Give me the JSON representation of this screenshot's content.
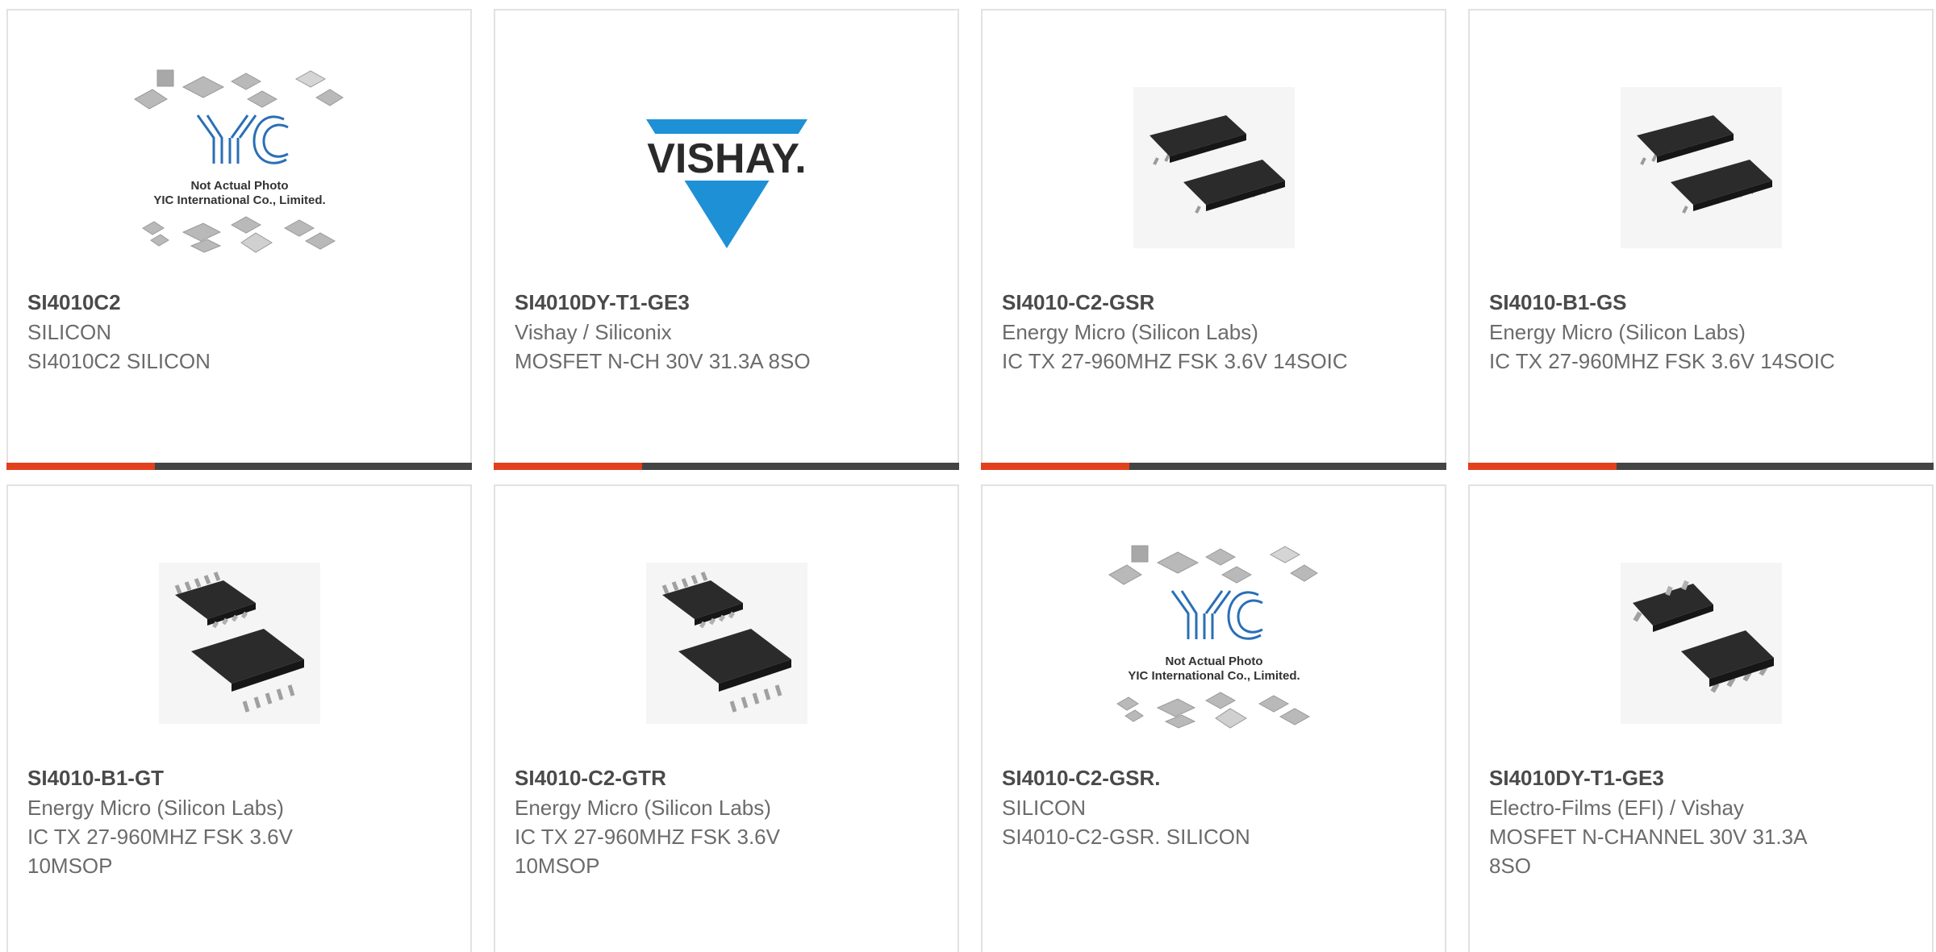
{
  "colors": {
    "accent": "#e2401c",
    "bar": "#444444",
    "vishay_blue": "#1e90d6",
    "chip": "#2b2b2b",
    "yic_blue": "#2a6fb5"
  },
  "placeholder": {
    "line1": "Not Actual Photo",
    "line2": "YIC International Co., Limited."
  },
  "products": [
    {
      "part_number": "SI4010C2",
      "manufacturer": "SILICON",
      "description": "SI4010C2 SILICON",
      "image": "yic-placeholder"
    },
    {
      "part_number": "SI4010DY-T1-GE3",
      "manufacturer": "Vishay / Siliconix",
      "description": "MOSFET N-CH 30V 31.3A 8SO",
      "image": "vishay-logo",
      "logo_text": "VISHAY."
    },
    {
      "part_number": "SI4010-C2-GSR",
      "manufacturer": "Energy Micro (Silicon Labs)",
      "description": "IC TX 27-960MHZ FSK 3.6V 14SOIC",
      "image": "soic14-chip"
    },
    {
      "part_number": "SI4010-B1-GS",
      "manufacturer": "Energy Micro (Silicon Labs)",
      "description": "IC TX 27-960MHZ FSK 3.6V 14SOIC",
      "image": "soic14-chip"
    },
    {
      "part_number": "SI4010-B1-GT",
      "manufacturer": "Energy Micro (Silicon Labs)",
      "description": "IC TX 27-960MHZ FSK 3.6V 10MSOP",
      "image": "msop10-chip"
    },
    {
      "part_number": "SI4010-C2-GTR",
      "manufacturer": "Energy Micro (Silicon Labs)",
      "description": "IC TX 27-960MHZ FSK 3.6V 10MSOP",
      "image": "msop10-chip"
    },
    {
      "part_number": "SI4010-C2-GSR.",
      "manufacturer": "SILICON",
      "description": "SI4010-C2-GSR. SILICON",
      "image": "yic-placeholder"
    },
    {
      "part_number": "SI4010DY-T1-GE3",
      "manufacturer": "Electro-Films (EFI) / Vishay",
      "description": "MOSFET N-CHANNEL 30V 31.3A 8SO",
      "image": "so8-chip"
    }
  ]
}
